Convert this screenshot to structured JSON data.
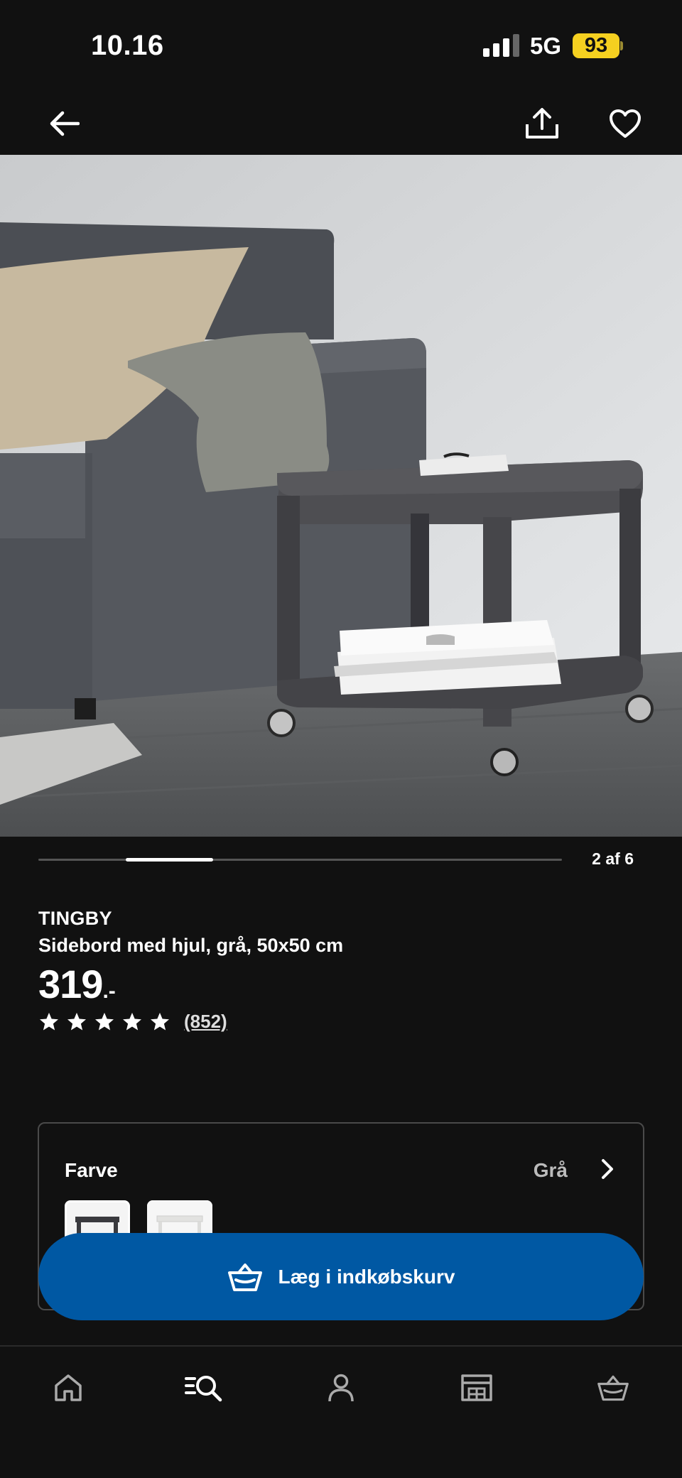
{
  "status_bar": {
    "time": "10.16",
    "network": "5G",
    "battery": "93"
  },
  "nav": {
    "icons": [
      "back-arrow-icon",
      "share-icon",
      "heart-icon"
    ]
  },
  "gallery": {
    "counter": "2 af 6",
    "position": 2,
    "total": 6
  },
  "product": {
    "name": "TINGBY",
    "description": "Sidebord med hjul, grå, 50x50 cm",
    "price_integer": "319",
    "price_decimal": ".-",
    "rating_stars": 5,
    "review_count": "(852)"
  },
  "color_option": {
    "label": "Farve",
    "value": "Grå",
    "swatches": [
      "Grå",
      "Hvid"
    ]
  },
  "add_to_cart": {
    "label": "Læg i indkøbskurv"
  },
  "bottom_nav": {
    "tabs": [
      "home-icon",
      "search-icon",
      "profile-icon",
      "store-icon",
      "basket-icon"
    ]
  },
  "colors": {
    "background": "#111111",
    "primary_button": "#0058a3",
    "battery": "#f5d020"
  }
}
